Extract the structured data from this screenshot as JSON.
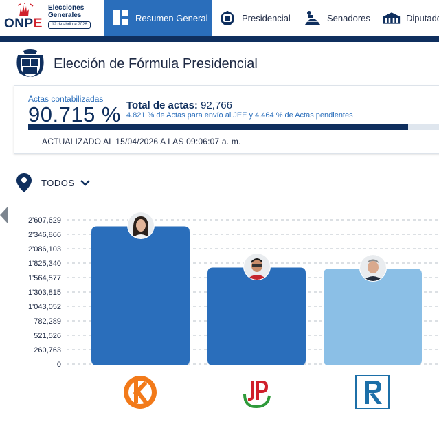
{
  "header": {
    "logo_text_a": "ONP",
    "logo_text_b": "E",
    "elections_title": "Elecciones Generales",
    "elections_date": "12 de abril de 2026",
    "nav": [
      {
        "label": "Resumen General",
        "active": true,
        "icon": "dashboard-icon"
      },
      {
        "label": "Presidencial",
        "active": false,
        "icon": "coat-of-arms-icon"
      },
      {
        "label": "Senadores",
        "active": false,
        "icon": "senate-icon"
      },
      {
        "label": "Diputados",
        "active": false,
        "icon": "congress-building-icon"
      }
    ]
  },
  "page": {
    "title": "Elección de Fórmula Presidencial",
    "icon": "peru-coat-of-arms-icon"
  },
  "summary": {
    "actas_label": "Actas contabilizadas",
    "actas_value": "90.715 %",
    "actas_fraction": 0.90715,
    "total_label": "Total de actas:",
    "total_value": "92,766",
    "pending_text": "4.821 % de Actas para envío al JEE y 4.464 % de Actas pendientes",
    "updated_text": "ACTUALIZADO AL 15/04/2026 A LAS 09:06:07 a. m."
  },
  "filter": {
    "label": "TODOS",
    "icon": "location-pin-icon",
    "chevron": "chevron-down-icon"
  },
  "colors": {
    "navy": "#0f2f5e",
    "accent_blue": "#2a6ebb",
    "bar_dark": "#2a6ebb",
    "bar_light": "#8bbfe6",
    "grid": "#b9c0c8"
  },
  "chart_data": {
    "type": "bar",
    "categories": [
      "K",
      "JP",
      "R"
    ],
    "values": [
      2490000,
      1745000,
      1725000
    ],
    "bar_colors": [
      "#2a6ebb",
      "#2a6ebb",
      "#8bbfe6"
    ],
    "party_logos": [
      "fuerza-popular-k-logo",
      "juntos-por-el-peru-jp-logo",
      "renovacion-popular-r-logo"
    ],
    "y_ticks": [
      0,
      260763,
      521526,
      782289,
      1043052,
      1303815,
      1564577,
      1825340,
      2086103,
      2346866,
      2607629
    ],
    "y_tick_labels": [
      "0",
      "260,763",
      "521,526",
      "782,289",
      "1'043,052",
      "1'303,815",
      "1'564,577",
      "1'825,340",
      "2'086,103",
      "2'346,866",
      "2'607,629"
    ],
    "ylim": [
      0,
      2607629
    ],
    "grid": true
  }
}
